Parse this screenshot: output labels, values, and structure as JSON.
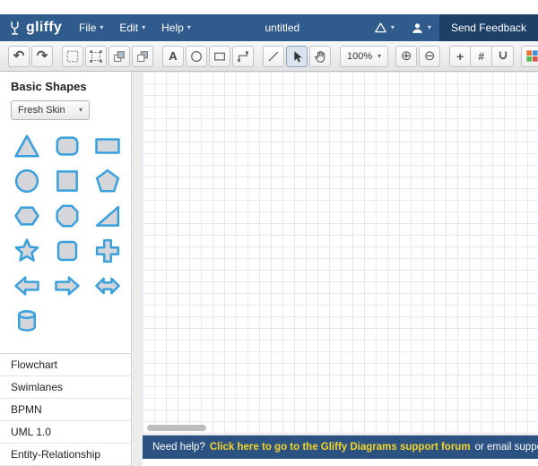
{
  "colors": {
    "navbar_blue": "#2f5b8d",
    "send_feedback_bg": "#1d4166",
    "help_bar_blue": "#2b5280",
    "link_yellow": "#f4d42a",
    "shape_stroke_blue": "#3aa0dc",
    "shape_fill_gray": "#d4d6d9"
  },
  "navbar": {
    "logo_text": "gliffy",
    "menus": [
      {
        "label": "File"
      },
      {
        "label": "Edit"
      },
      {
        "label": "Help"
      }
    ],
    "document_title": "untitled",
    "send_feedback_label": "Send Feedback",
    "icons": [
      "gliffy-logo-icon",
      "google-drive-icon",
      "user-icon"
    ]
  },
  "toolbar": {
    "zoom_level": "100%",
    "items": [
      {
        "type": "group",
        "buttons": [
          {
            "name": "undo-button",
            "icon": "undo-icon"
          },
          {
            "name": "redo-button",
            "icon": "redo-icon"
          }
        ]
      },
      {
        "type": "group",
        "buttons": [
          {
            "name": "select-area-button",
            "icon": "marquee-icon"
          },
          {
            "name": "multi-select-button",
            "icon": "marquee-dots-icon"
          },
          {
            "name": "bring-to-front-button",
            "icon": "bring-front-icon"
          },
          {
            "name": "send-to-back-button",
            "icon": "send-back-icon"
          }
        ]
      },
      {
        "type": "group",
        "buttons": [
          {
            "name": "text-tool-button",
            "icon": "text-icon"
          },
          {
            "name": "ellipse-tool-button",
            "icon": "ellipse-icon"
          },
          {
            "name": "rectangle-tool-button",
            "icon": "rectangle-icon"
          },
          {
            "name": "connector-tool-button",
            "icon": "connector-icon"
          }
        ]
      },
      {
        "type": "group",
        "buttons": [
          {
            "name": "line-tool-button",
            "icon": "line-icon"
          },
          {
            "name": "pointer-tool-button",
            "icon": "pointer-icon",
            "active": true
          },
          {
            "name": "pan-tool-button",
            "icon": "hand-icon"
          }
        ]
      },
      {
        "type": "dropdown",
        "name": "zoom-level-dropdown",
        "value": "100%"
      },
      {
        "type": "group",
        "buttons": [
          {
            "name": "zoom-in-button",
            "icon": "zoom-in-icon"
          },
          {
            "name": "zoom-out-button",
            "icon": "zoom-out-icon"
          }
        ]
      },
      {
        "type": "segmented",
        "buttons": [
          {
            "name": "expand-canvas-button",
            "icon": "plus-icon"
          },
          {
            "name": "grid-toggle-button",
            "icon": "grid-icon"
          },
          {
            "name": "snap-to-grid-button",
            "icon": "magnet-icon"
          }
        ]
      },
      {
        "type": "group",
        "buttons": [
          {
            "name": "theme-palette-button",
            "icon": "palette-icon"
          }
        ]
      }
    ]
  },
  "shapes_panel": {
    "title": "Basic Shapes",
    "skin_selector": {
      "value": "Fresh Skin"
    },
    "shapes": [
      "triangle",
      "rounded-rectangle",
      "rectangle",
      "circle",
      "square",
      "pentagon",
      "hexagon",
      "octagon",
      "right-triangle",
      "star",
      "rounded-square",
      "cross",
      "arrow-left",
      "arrow-right",
      "arrow-double",
      "cylinder"
    ],
    "categories": [
      "Flowchart",
      "Swimlanes",
      "BPMN",
      "UML 1.0",
      "Entity-Relationship"
    ]
  },
  "helpbar": {
    "prefix": "Need help?",
    "link_text": "Click here to go to the Gliffy Diagrams support forum",
    "suffix": "or email support@gliffy.com"
  }
}
